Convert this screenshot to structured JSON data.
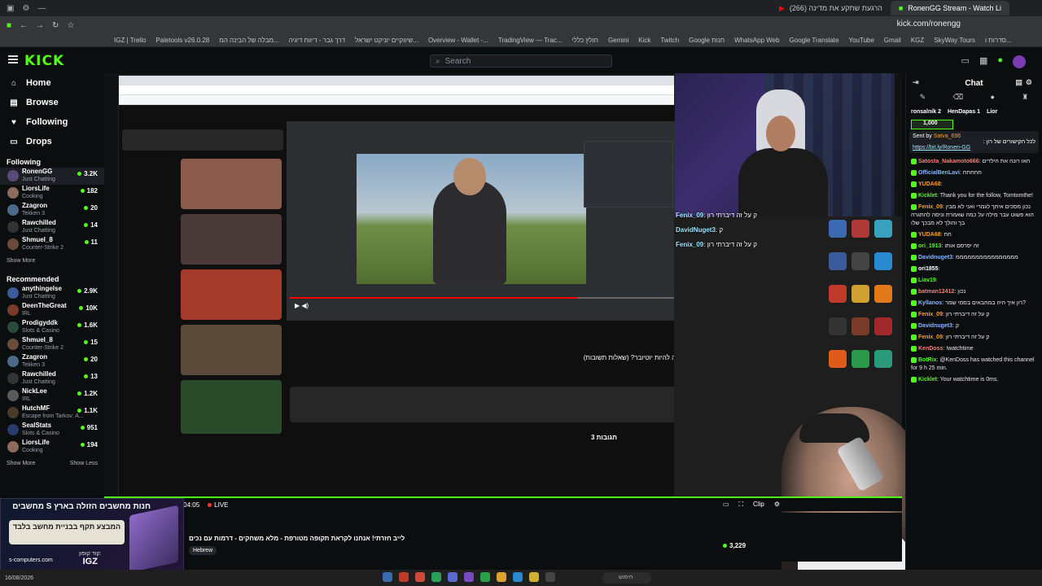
{
  "browser": {
    "tabs": [
      {
        "label": "הרגעת שתקע את מדינה (266)"
      },
      {
        "label": "RonenGG Stream - Watch Li"
      }
    ],
    "url": "kick.com/ronengg",
    "bookmarks": [
      "IGZ | Trello",
      "Paletools v26.0.28",
      "מבלה של הבינה המ...",
      "דרך גבר - דיווח דיגיה",
      "שיווקיים יוניקט ישראל...",
      "Overview - Wallet -...",
      "TradingView — Trac...",
      "חולץ כללי",
      "Gemini",
      "Kick",
      "Twitch",
      "Google חנות",
      "WhatsApp Web",
      "Google Translate",
      "YouTube",
      "Gmail",
      "KGZ",
      "SkyWay Tours",
      "סדרות ו..."
    ]
  },
  "header": {
    "logo": "KICK",
    "search_placeholder": "Search"
  },
  "sidebar": {
    "nav": [
      {
        "label": "Home",
        "icon": "home-icon",
        "glyph": "⌂"
      },
      {
        "label": "Browse",
        "icon": "browse-icon",
        "glyph": "▤"
      },
      {
        "label": "Following",
        "icon": "heart-icon",
        "glyph": "♥"
      },
      {
        "label": "Drops",
        "icon": "drops-icon",
        "glyph": "▭"
      }
    ],
    "following_title": "Following",
    "following": [
      {
        "name": "RonenGG",
        "game": "Just Chatting",
        "viewers": "3.2K",
        "color": "#5a4a7a"
      },
      {
        "name": "LiorsLife",
        "game": "Cooking",
        "viewers": "182",
        "color": "#8b6b5a"
      },
      {
        "name": "Zzagron",
        "game": "Tekken 3",
        "viewers": "20",
        "color": "#4b6a8a"
      },
      {
        "name": "Rawchilled",
        "game": "Just Chatting",
        "viewers": "14",
        "color": "#333"
      },
      {
        "name": "Shmuel_8",
        "game": "Counter-Strike 2",
        "viewers": "11",
        "color": "#6b4b3a"
      }
    ],
    "show_more_1": "Show More",
    "recommended_title": "Recommended",
    "recommended": [
      {
        "name": "anythingelse",
        "game": "Just Chatting",
        "viewers": "2.9K",
        "color": "#3a5a9a"
      },
      {
        "name": "DeenTheGreat",
        "game": "IRL",
        "viewers": "10K",
        "color": "#7a3a2a"
      },
      {
        "name": "Prodigyddk",
        "game": "Slots & Casino",
        "viewers": "1.6K",
        "color": "#2a4a3a"
      },
      {
        "name": "Shmuel_8",
        "game": "Counter-Strike 2",
        "viewers": "15",
        "color": "#6b4b3a"
      },
      {
        "name": "Zzagron",
        "game": "Tekken 3",
        "viewers": "20",
        "color": "#4b6a8a"
      },
      {
        "name": "Rawchilled",
        "game": "Just Chatting",
        "viewers": "13",
        "color": "#333"
      },
      {
        "name": "NickLee",
        "game": "IRL",
        "viewers": "1.2K",
        "color": "#5a5a5a"
      },
      {
        "name": "HutchMF",
        "game": "Escape from Tarkov: A...",
        "viewers": "1.1K",
        "color": "#4a3a2a"
      },
      {
        "name": "SealStats",
        "game": "Slots & Casino",
        "viewers": "951",
        "color": "#2a3a6a"
      },
      {
        "name": "LiorsLife",
        "game": "Cooking",
        "viewers": "194",
        "color": "#8b6b5a"
      }
    ],
    "show_more_2": "Show More",
    "show_less": "Show Less"
  },
  "inner_video": {
    "yt_title": "איך זה להיות יוטיובר? (שאלות תשובות)",
    "comments": "3 תגובות",
    "overlay_chat": [
      {
        "user": "Fenix_09",
        "text": "ק על זה דיברתי רון"
      },
      {
        "user": "DavidNuget3",
        "text": "ק"
      },
      {
        "user": "Fenix_09",
        "text": "ק על זה דיברתי רון"
      }
    ]
  },
  "player": {
    "time": "05:04:05",
    "live_label": "LIVE",
    "clip_label": "Clip"
  },
  "stream": {
    "title": "לייב חזרתי! אנחנו לקראת תקופה מטורפת - מלא משחקים - דרמות עם נכים",
    "language": "Hebrew",
    "viewers": "3,229"
  },
  "ad": {
    "headline": "חנות מחשבים הזולה בארץ",
    "brand": "S מחשבים",
    "tagline": "המבצע תקף בבניית מחשב בלבד",
    "site": "s-computers.com",
    "code_label": "קוד קופון:",
    "code": "IGZ"
  },
  "chat": {
    "title": "Chat",
    "pinned_users": [
      {
        "name": "ronsalnik",
        "n": "2"
      },
      {
        "name": "HenDapas",
        "n": "1"
      },
      {
        "name": "Lior",
        "n": ""
      }
    ],
    "gift": "1,000",
    "pinned": {
      "sender": "Sent by",
      "sender_name": "Satva_696",
      "line": "לכל הקישורים של רון :",
      "link": "https://bit.ly/Ronen-GG"
    },
    "messages": [
      {
        "user": "Satosta_Nakamoto666",
        "text": "האו רונה את הילדים",
        "color": "#ff7a7a"
      },
      {
        "user": "OfficialBenLavi",
        "text": "חחחחח",
        "color": "#8ab4ff"
      },
      {
        "user": "YUDA68",
        "text": "",
        "color": "#ff9e2c"
      },
      {
        "user": "Kicklet",
        "text": "Thank you for the follow, Tomtomthe!",
        "color": "#53fc18"
      },
      {
        "user": "Fenix_09",
        "text": "נכון מסכים איתך לגמרי ואני לא מבין הוא פשוט עבר מילה על כמה שאמרת וניסה להתגרה בך והולך לא מבכך שלו",
        "color": "#ff9e2c"
      },
      {
        "user": "YUDA68",
        "text": "חח",
        "color": "#ff9e2c"
      },
      {
        "user": "ori_1913",
        "text": "זה יפרסם אותו",
        "color": "#53fc18"
      },
      {
        "user": "Davidnuget3",
        "text": "ממממממממממממממממ",
        "color": "#8ab4ff"
      },
      {
        "user": "ori1855",
        "text": "",
        "color": "#ffffff"
      },
      {
        "user": "Liav19",
        "text": "",
        "color": "#53fc18"
      },
      {
        "user": "batman12412",
        "text": "נכון",
        "color": "#ff7a7a"
      },
      {
        "user": "Kyllanos",
        "text": "רון איך היה במחבאים בסמי שמר?",
        "color": "#8ab4ff"
      },
      {
        "user": "Fenix_09",
        "text": "ק על זה דיברתי רון",
        "color": "#ff9e2c"
      },
      {
        "user": "Davidnuget3",
        "text": "ק",
        "color": "#8ab4ff"
      },
      {
        "user": "Fenix_09",
        "text": "ק על זה דיברתי רון",
        "color": "#ff9e2c"
      },
      {
        "user": "KenDoss",
        "text": "!watchtime",
        "color": "#ff7a7a"
      },
      {
        "user": "BotRix",
        "text": "@KenDoss has watched this channel for 9 h 25 min.",
        "color": "#53fc18"
      },
      {
        "user": "Kicklet",
        "text": "Your watchtime is 0ms.",
        "color": "#53fc18"
      }
    ]
  },
  "taskbar": {
    "date": "16/08/2026",
    "search": "חיפוש"
  }
}
